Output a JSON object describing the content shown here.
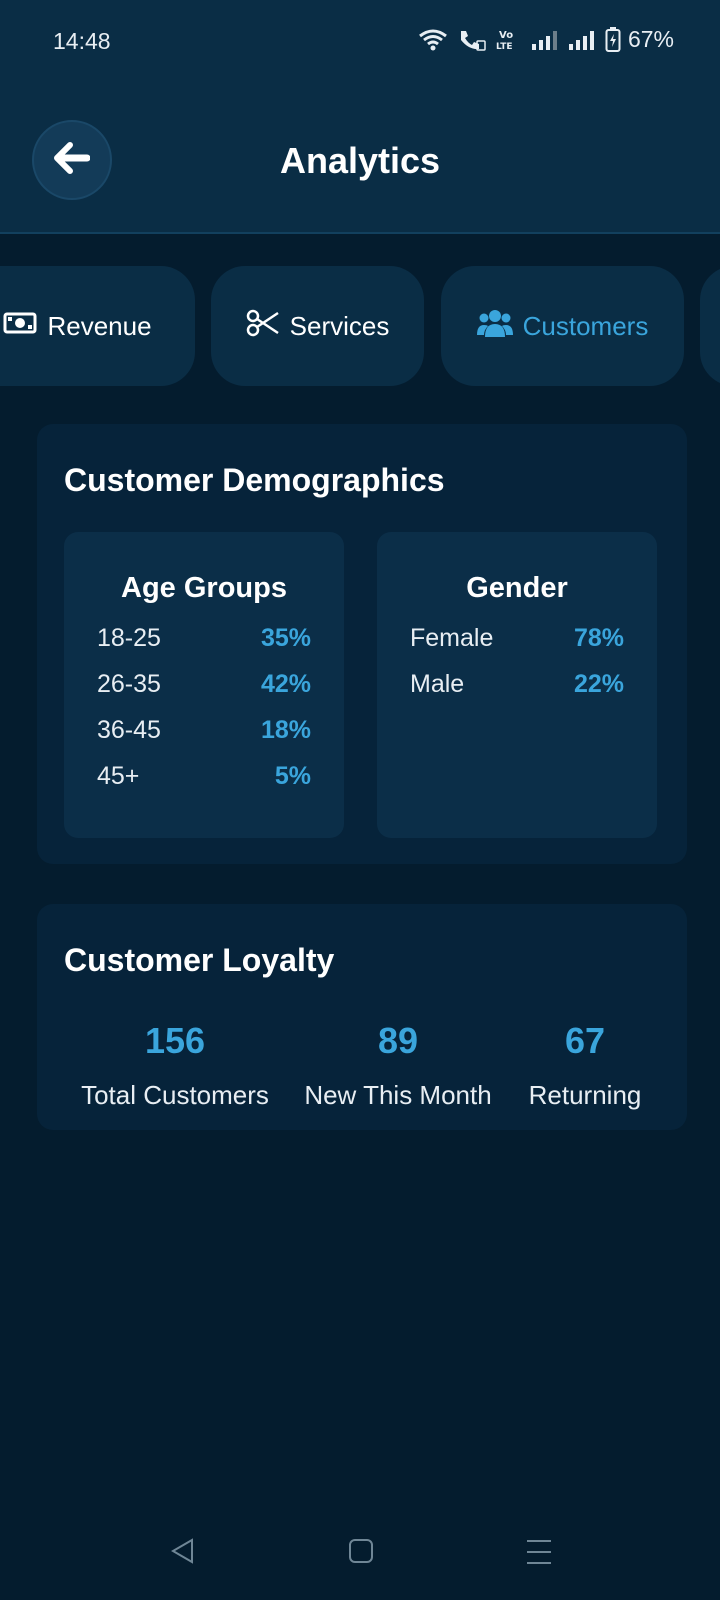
{
  "status_bar": {
    "time": "14:48",
    "battery": "67%",
    "icons": [
      "wifi-icon",
      "wifi-call-icon",
      "volte-icon",
      "signal-icon",
      "signal-icon",
      "battery-icon"
    ]
  },
  "header": {
    "title": "Analytics",
    "back_icon": "arrow-left-icon"
  },
  "tabs": [
    {
      "label": "Revenue",
      "icon": "money-icon",
      "active": false
    },
    {
      "label": "Services",
      "icon": "scissors-icon",
      "active": false
    },
    {
      "label": "Customers",
      "icon": "users-icon",
      "active": true
    }
  ],
  "demographics": {
    "title": "Customer Demographics",
    "age": {
      "title": "Age Groups",
      "rows": [
        {
          "label": "18-25",
          "value": "35%"
        },
        {
          "label": "26-35",
          "value": "42%"
        },
        {
          "label": "36-45",
          "value": "18%"
        },
        {
          "label": "45+",
          "value": "5%"
        }
      ]
    },
    "gender": {
      "title": "Gender",
      "rows": [
        {
          "label": "Female",
          "value": "78%"
        },
        {
          "label": "Male",
          "value": "22%"
        }
      ]
    }
  },
  "loyalty": {
    "title": "Customer Loyalty",
    "stats": [
      {
        "value": "156",
        "label": "Total Customers"
      },
      {
        "value": "89",
        "label": "New This Month"
      },
      {
        "value": "67",
        "label": "Returning"
      }
    ]
  },
  "colors": {
    "accent": "#3aa5dc",
    "background": "#041c2e",
    "header": "#0a2d45"
  },
  "nav_bar": {
    "icons": [
      "back-triangle-icon",
      "home-square-icon",
      "menu-lines-icon"
    ]
  }
}
